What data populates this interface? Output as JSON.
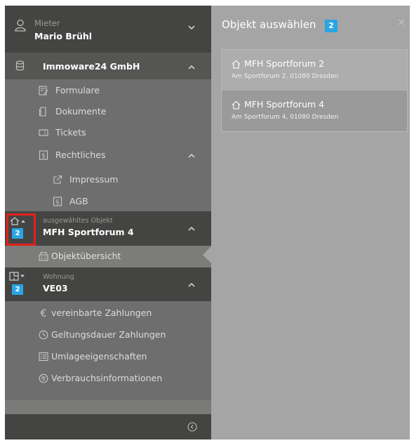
{
  "tenant": {
    "label": "Mieter",
    "name": "Mario Brühl"
  },
  "company": {
    "name": "Immoware24 GmbH"
  },
  "menu": {
    "formulare": "Formulare",
    "dokumente": "Dokumente",
    "tickets": "Tickets",
    "rechtliches": "Rechtliches",
    "impressum": "Impressum",
    "agb": "AGB"
  },
  "objekt": {
    "label": "ausgewähltes Objekt",
    "name": "MFH Sportforum 4",
    "count": "2",
    "uebersicht": "Objektübersicht"
  },
  "wohnung": {
    "label": "Wohnung",
    "name": "VE03",
    "count": "2",
    "items": [
      "vereinbarte Zahlungen",
      "Geltungsdauer Zahlungen",
      "Umlageeigenschaften",
      "Verbrauchsinformationen"
    ]
  },
  "panel": {
    "title": "Objekt auswählen",
    "count": "2",
    "close": "×",
    "objects": [
      {
        "name": "MFH Sportforum 2",
        "address": "Am Sportforum 2, 01080 Dresden"
      },
      {
        "name": "MFH Sportforum 4",
        "address": "Am Sportforum 4, 01080 Dresden"
      }
    ]
  },
  "colors": {
    "accent": "#2aa4e4",
    "highlight": "#e3201b",
    "sidebar": "#6e6e6e",
    "header": "#444443"
  }
}
